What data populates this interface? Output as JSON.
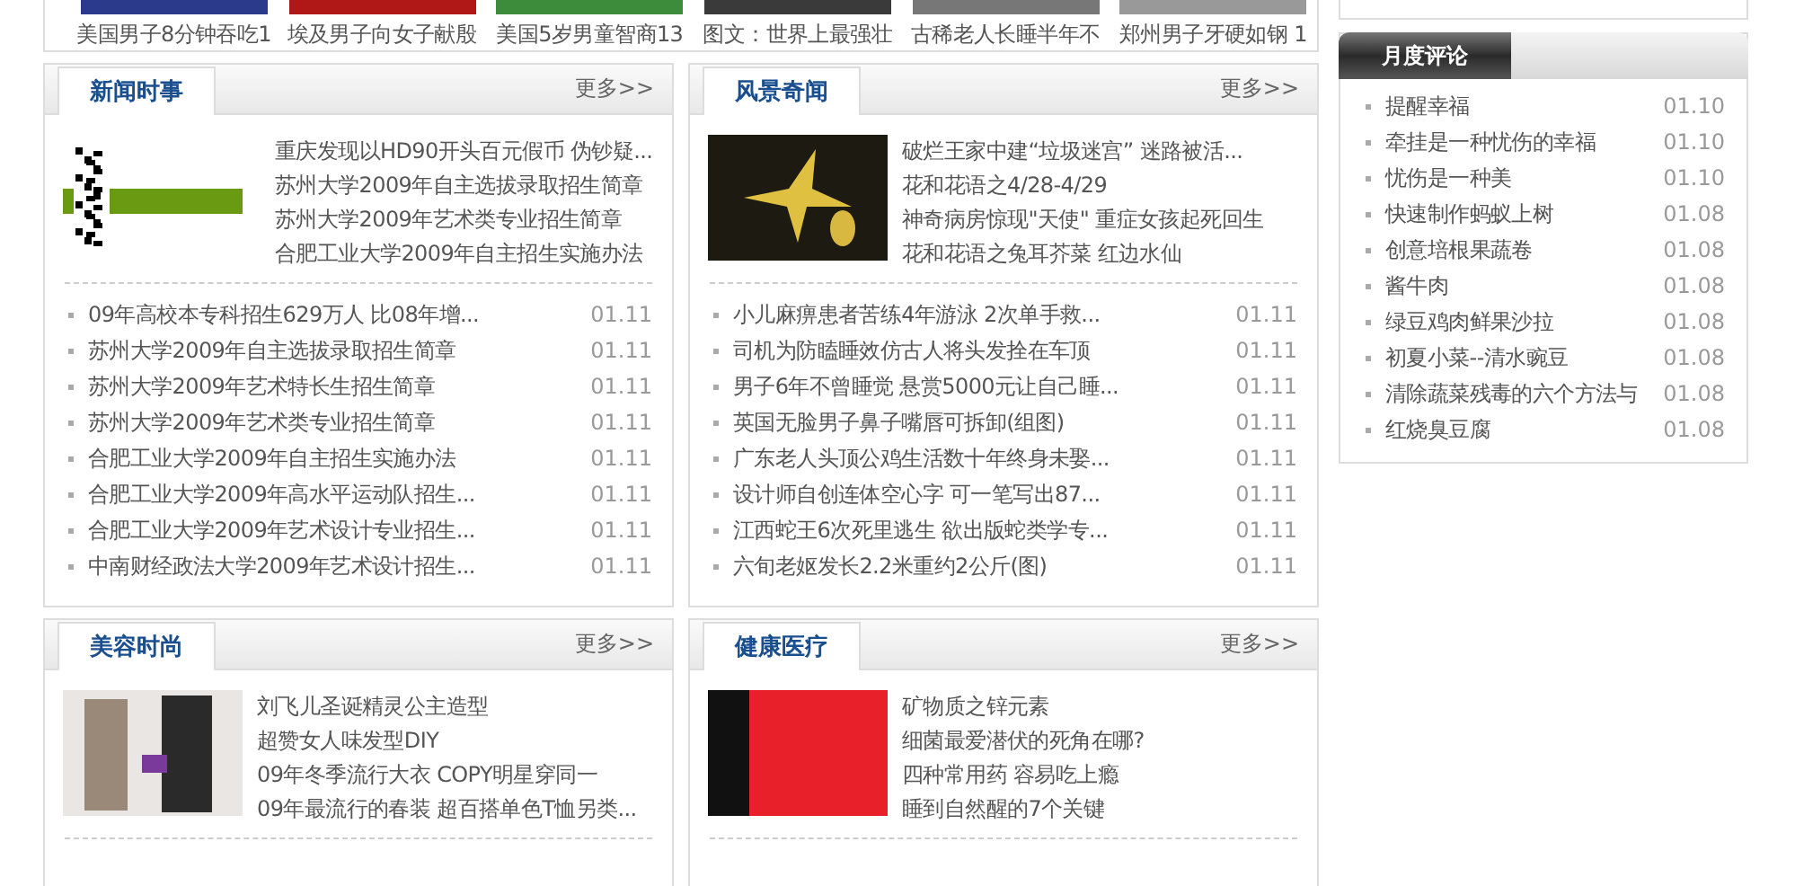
{
  "top_strip": {
    "captions": [
      "美国男子8分钟吞吃1",
      "埃及男子向女子献殷",
      "美国5岁男童智商13",
      "图文：世界上最强壮",
      "古稀老人长睡半年不",
      "郑州男子牙硬如钢 1"
    ]
  },
  "panels": [
    {
      "title": "新闻时事",
      "more": "更多>>",
      "image": {
        "kind": "pattern"
      },
      "headlines": [
        "重庆发现以HD90开头百元假币 伪钞疑...",
        "苏州大学2009年自主选拔录取招生简章",
        "苏州大学2009年艺术类专业招生简章",
        "合肥工业大学2009年自主招生实施办法"
      ],
      "items": [
        {
          "title": "09年高校本专科招生629万人 比08年增...",
          "date": "01.11"
        },
        {
          "title": "苏州大学2009年自主选拔录取招生简章",
          "date": "01.11"
        },
        {
          "title": "苏州大学2009年艺术特长生招生简章",
          "date": "01.11"
        },
        {
          "title": "苏州大学2009年艺术类专业招生简章",
          "date": "01.11"
        },
        {
          "title": "合肥工业大学2009年自主招生实施办法",
          "date": "01.11"
        },
        {
          "title": "合肥工业大学2009年高水平运动队招生...",
          "date": "01.11"
        },
        {
          "title": "合肥工业大学2009年艺术设计专业招生...",
          "date": "01.11"
        },
        {
          "title": "中南财经政法大学2009年艺术设计招生...",
          "date": "01.11"
        }
      ]
    },
    {
      "title": "风景奇闻",
      "more": "更多>>",
      "image": {
        "kind": "flower"
      },
      "headlines": [
        "破烂王家中建“垃圾迷宫” 迷路被活...",
        "花和花语之4/28-4/29",
        "神奇病房惊现\"天使\" 重症女孩起死回生",
        "花和花语之兔耳芥菜 红边水仙"
      ],
      "items": [
        {
          "title": "小儿麻痹患者苦练4年游泳 2次单手救...",
          "date": "01.11"
        },
        {
          "title": "司机为防瞌睡效仿古人将头发拴在车顶",
          "date": "01.11"
        },
        {
          "title": "男子6年不曾睡觉 悬赏5000元让自己睡...",
          "date": "01.11"
        },
        {
          "title": "英国无脸男子鼻子嘴唇可拆卸(组图)",
          "date": "01.11"
        },
        {
          "title": "广东老人头顶公鸡生活数十年终身未娶...",
          "date": "01.11"
        },
        {
          "title": "设计师自创连体空心字 可一笔写出87...",
          "date": "01.11"
        },
        {
          "title": "江西蛇王6次死里逃生 欲出版蛇类学专...",
          "date": "01.11"
        },
        {
          "title": "六旬老妪发长2.2米重约2公斤(图)",
          "date": "01.11"
        }
      ]
    },
    {
      "title": "美容时尚",
      "more": "更多>>",
      "image": {
        "kind": "fashion"
      },
      "headlines": [
        "刘飞儿圣诞精灵公主造型",
        "超赞女人味发型DIY",
        "09年冬季流行大衣 COPY明星穿同一",
        "09年最流行的春装 超百搭单色T恤另类..."
      ]
    },
    {
      "title": "健康医疗",
      "more": "更多>>",
      "image": {
        "kind": "banner"
      },
      "headlines": [
        "矿物质之锌元素",
        "细菌最爱潜伏的死角在哪?",
        "四种常用药 容易吃上瘾",
        "睡到自然醒的7个关键"
      ]
    }
  ],
  "sidebar": {
    "monthly": {
      "title": "月度评论",
      "items": [
        {
          "title": "提醒幸福",
          "date": "01.10"
        },
        {
          "title": "牵挂是一种忧伤的幸福",
          "date": "01.10"
        },
        {
          "title": "忧伤是一种美",
          "date": "01.10"
        },
        {
          "title": "快速制作蚂蚁上树",
          "date": "01.08"
        },
        {
          "title": "创意培根果蔬卷",
          "date": "01.08"
        },
        {
          "title": "酱牛肉",
          "date": "01.08"
        },
        {
          "title": "绿豆鸡肉鲜果沙拉",
          "date": "01.08"
        },
        {
          "title": "初夏小菜--清水豌豆",
          "date": "01.08"
        },
        {
          "title": "清除蔬菜残毒的六个方法与",
          "date": "01.08"
        },
        {
          "title": "红烧臭豆腐",
          "date": "01.08"
        }
      ]
    }
  }
}
